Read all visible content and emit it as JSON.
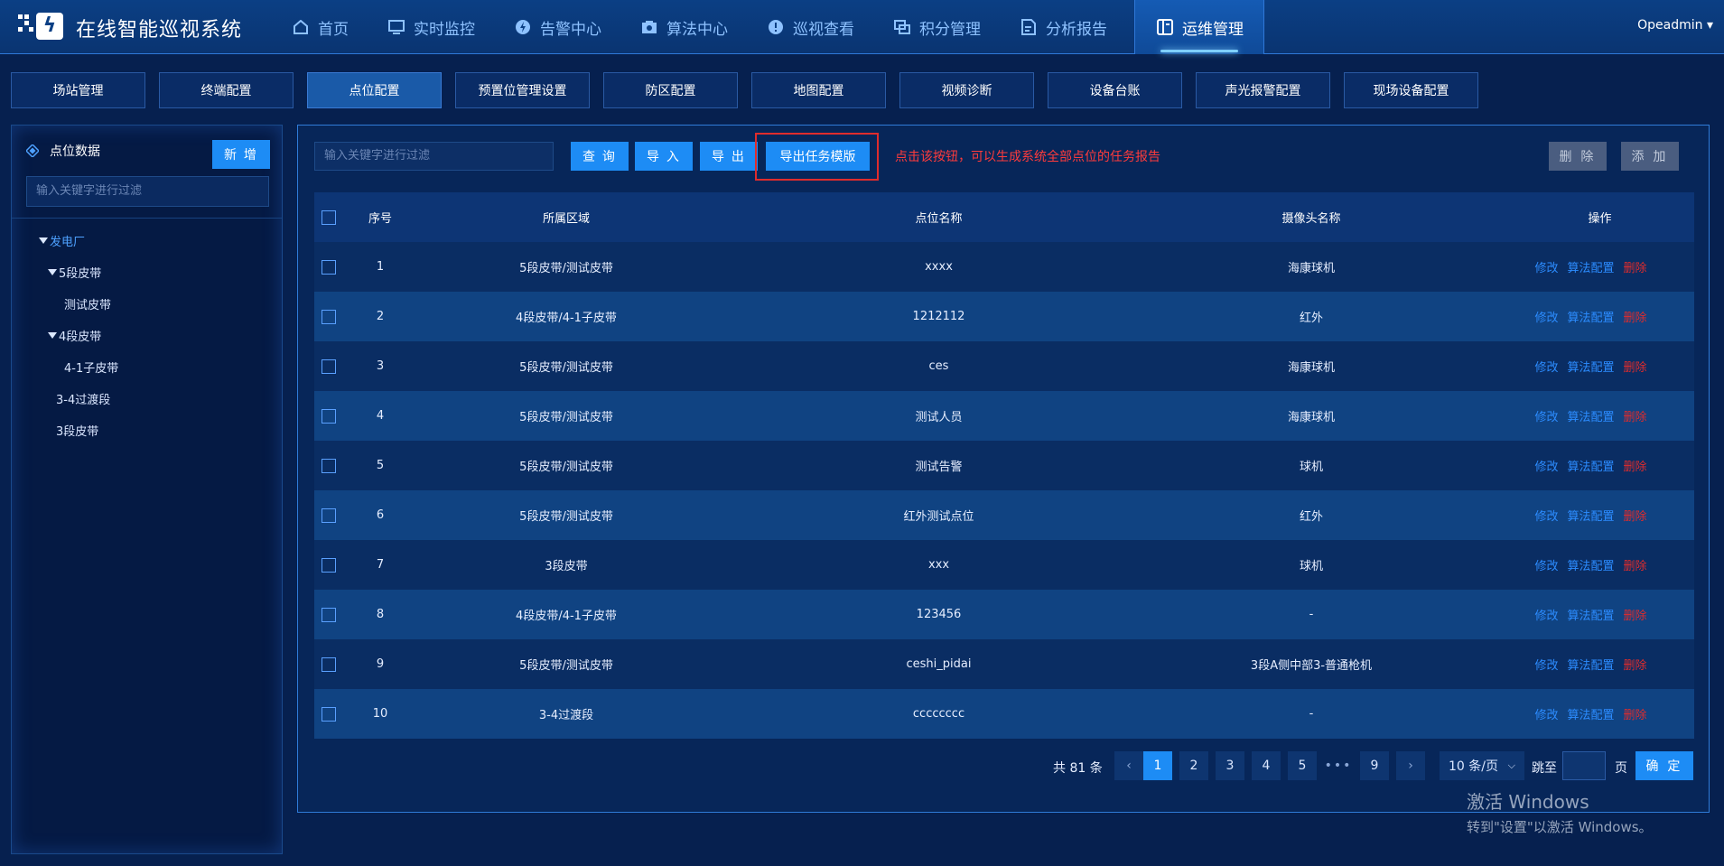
{
  "app": {
    "title": "在线智能巡视系统",
    "user": "Opeadmin"
  },
  "nav": [
    {
      "label": "首页",
      "icon": "home-icon"
    },
    {
      "label": "实时监控",
      "icon": "monitor-icon"
    },
    {
      "label": "告警中心",
      "icon": "alert-icon"
    },
    {
      "label": "算法中心",
      "icon": "algorithm-icon"
    },
    {
      "label": "巡视查看",
      "icon": "inspect-icon"
    },
    {
      "label": "积分管理",
      "icon": "points-icon"
    },
    {
      "label": "分析报告",
      "icon": "report-icon"
    },
    {
      "label": "运维管理",
      "icon": "ops-icon",
      "active": true
    }
  ],
  "subtabs": [
    "场站管理",
    "终端配置",
    "点位配置",
    "预置位管理设置",
    "防区配置",
    "地图配置",
    "视频诊断",
    "设备台账",
    "声光报警配置",
    "现场设备配置"
  ],
  "left": {
    "title": "点位数据",
    "new_label": "新 增",
    "search_placeholder": "输入关键字进行过滤",
    "tree": [
      {
        "label": "发电厂"
      },
      {
        "label": "5段皮带"
      },
      {
        "label": "测试皮带"
      },
      {
        "label": "4段皮带"
      },
      {
        "label": "4-1子皮带"
      },
      {
        "label": "3-4过渡段"
      },
      {
        "label": "3段皮带"
      }
    ]
  },
  "toolbar": {
    "search_placeholder": "输入关键字进行过滤",
    "query_label": "查 询",
    "import_label": "导 入",
    "export_label": "导 出",
    "export_template_label": "导出任务模版",
    "annotation": "点击该按钮，可以生成系统全部点位的任务报告",
    "delete_label": "删 除",
    "add_label": "添 加"
  },
  "table": {
    "headers": [
      "序号",
      "所属区域",
      "点位名称",
      "摄像头名称",
      "操作"
    ],
    "ops": {
      "edit": "修改",
      "algo": "算法配置",
      "del": "删除"
    },
    "rows": [
      {
        "no": "1",
        "area": "5段皮带/测试皮带",
        "name": "xxxx",
        "cam": "海康球机"
      },
      {
        "no": "2",
        "area": "4段皮带/4-1子皮带",
        "name": "1212112",
        "cam": "红外"
      },
      {
        "no": "3",
        "area": "5段皮带/测试皮带",
        "name": "ces",
        "cam": "海康球机"
      },
      {
        "no": "4",
        "area": "5段皮带/测试皮带",
        "name": "测试人员",
        "cam": "海康球机"
      },
      {
        "no": "5",
        "area": "5段皮带/测试皮带",
        "name": "测试告警",
        "cam": "球机"
      },
      {
        "no": "6",
        "area": "5段皮带/测试皮带",
        "name": "红外测试点位",
        "cam": "红外"
      },
      {
        "no": "7",
        "area": "3段皮带",
        "name": "xxx",
        "cam": "球机"
      },
      {
        "no": "8",
        "area": "4段皮带/4-1子皮带",
        "name": "123456",
        "cam": "-"
      },
      {
        "no": "9",
        "area": "5段皮带/测试皮带",
        "name": "ceshi_pidai",
        "cam": "3段A侧中部3-普通枪机"
      },
      {
        "no": "10",
        "area": "3-4过渡段",
        "name": "cccccccc",
        "cam": "-"
      }
    ]
  },
  "pagination": {
    "total": "共 81 条",
    "pages": [
      "1",
      "2",
      "3",
      "4",
      "5",
      "9"
    ],
    "current": "1",
    "ellipsis": "•••",
    "page_size": "10 条/页",
    "jump_label": "跳至",
    "page_label": "页",
    "confirm_label": "确 定"
  },
  "watermark": {
    "line1": "激活 Windows",
    "line2": "转到\"设置\"以激活 Windows。"
  }
}
